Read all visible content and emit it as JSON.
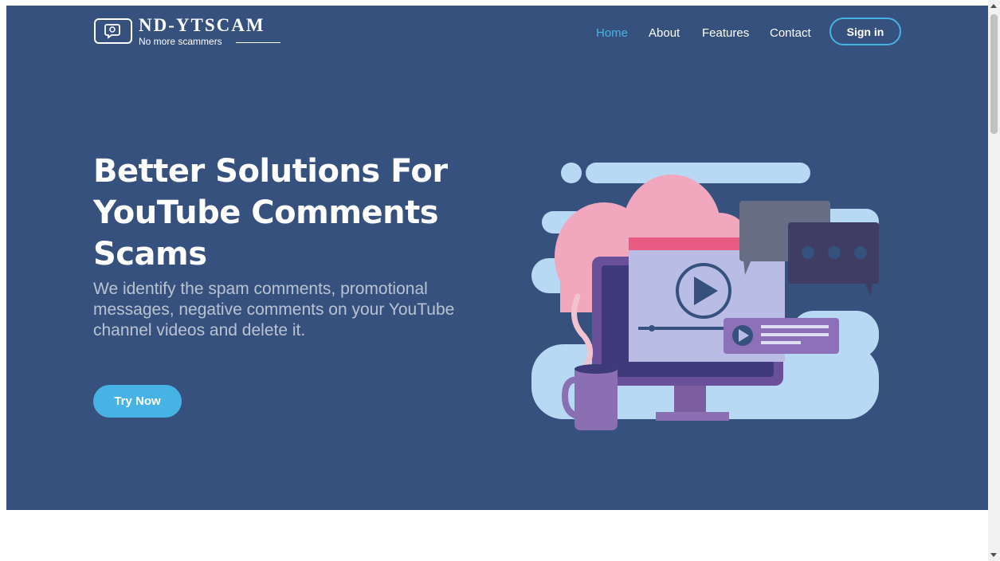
{
  "brand": {
    "title": "ND-YTSCAM",
    "tagline": "No more scammers",
    "icon": "speech-bubble-icon"
  },
  "nav": {
    "items": [
      {
        "label": "Home",
        "active": true
      },
      {
        "label": "About",
        "active": false
      },
      {
        "label": "Features",
        "active": false
      },
      {
        "label": "Contact",
        "active": false
      }
    ],
    "signin_label": "Sign in"
  },
  "hero": {
    "headline": "Better Solutions For YouTube Comments Scams",
    "subtext": "We identify the spam comments, promotional messages, negative comments on your YouTube channel videos and delete it.",
    "cta_label": "Try Now",
    "illustration": "video-monitor-with-chat-bubbles-illustration"
  },
  "colors": {
    "hero_bg": "#37517e",
    "accent": "#47b2e4",
    "text_light": "#ffffff"
  }
}
